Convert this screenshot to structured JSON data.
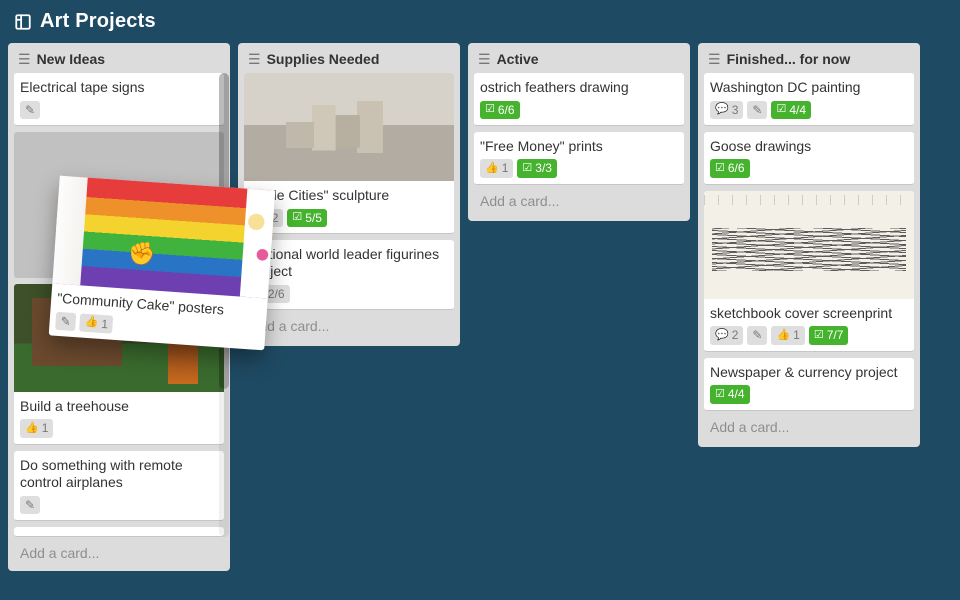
{
  "board": {
    "title": "Art Projects"
  },
  "addCardLabel": "Add a card...",
  "lists": {
    "newIdeas": {
      "title": "New Ideas",
      "cards": [
        {
          "title": "Electrical tape signs",
          "hasEdit": true
        },
        {
          "title": "Build a treehouse",
          "votes": "1",
          "cover": "treehouse"
        },
        {
          "title": "Do something with remote control airplanes",
          "hasEdit": true
        }
      ]
    },
    "supplies": {
      "title": "Supplies Needed",
      "cards": [
        {
          "title": "\"Little Cities\" sculpture",
          "votes": "2",
          "checklist": "5/5",
          "checklistDone": true,
          "cover": "boxes"
        },
        {
          "title": "Fictional world leader figurines project",
          "checklist": "2/6",
          "checklistDone": false
        }
      ]
    },
    "active": {
      "title": "Active",
      "cards": [
        {
          "title": "ostrich feathers drawing",
          "checklist": "6/6",
          "checklistDone": true
        },
        {
          "title": "\"Free Money\" prints",
          "votes": "1",
          "checklist": "3/3",
          "checklistDone": true
        }
      ]
    },
    "finished": {
      "title": "Finished... for now",
      "cards": [
        {
          "title": "Washington DC painting",
          "comments": "3",
          "hasEdit": true,
          "checklist": "4/4",
          "checklistDone": true
        },
        {
          "title": "Goose drawings",
          "checklist": "6/6",
          "checklistDone": true
        },
        {
          "title": "sketchbook cover screenprint",
          "comments": "2",
          "hasEdit": true,
          "votes": "1",
          "checklist": "7/7",
          "checklistDone": true,
          "cover": "sketch"
        },
        {
          "title": "Newspaper & currency project",
          "checklist": "4/4",
          "checklistDone": true
        }
      ]
    }
  },
  "draggedCard": {
    "title": "\"Community Cake\" posters",
    "votes": "1",
    "hasEdit": true,
    "cover": "cake"
  }
}
